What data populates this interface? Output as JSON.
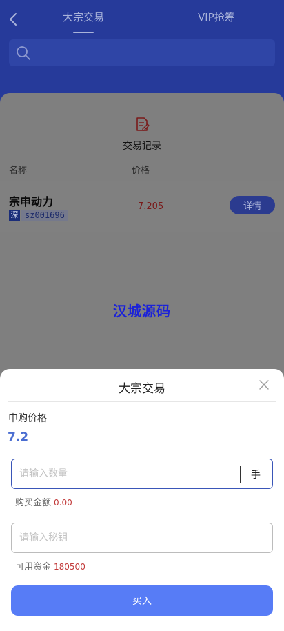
{
  "header": {
    "tabs": [
      {
        "label": "大宗交易",
        "active": true
      },
      {
        "label": "VIP抢筹",
        "active": false
      }
    ],
    "back_icon": "chevron-left-icon",
    "search": {
      "icon": "search-icon",
      "value": "",
      "placeholder": ""
    }
  },
  "list": {
    "record_icon": "document-edit-icon",
    "record_label": "交易记录",
    "columns": [
      "名称",
      "价格"
    ],
    "rows": [
      {
        "name": "宗申动力",
        "exchange": "深",
        "code": "sz001696",
        "price": "7.205",
        "action": "详情"
      }
    ]
  },
  "watermark": "汉城源码",
  "sheet": {
    "title": "大宗交易",
    "close_icon": "close-icon",
    "price_label": "申购价格",
    "price_value": "7.2",
    "quantity": {
      "value": "",
      "placeholder": "请输入数量",
      "unit": "手"
    },
    "amount_label": "购买金额",
    "amount_value": "0.00",
    "password": {
      "value": "",
      "placeholder": "请输入秘钥"
    },
    "funds_label": "可用资金",
    "funds_value": "180500",
    "submit_label": "买入"
  },
  "colors": {
    "header_bg": "#263a9a",
    "accent": "#577cf6",
    "price_blue": "#4a6dd1",
    "amount_red": "#c23a3a"
  }
}
